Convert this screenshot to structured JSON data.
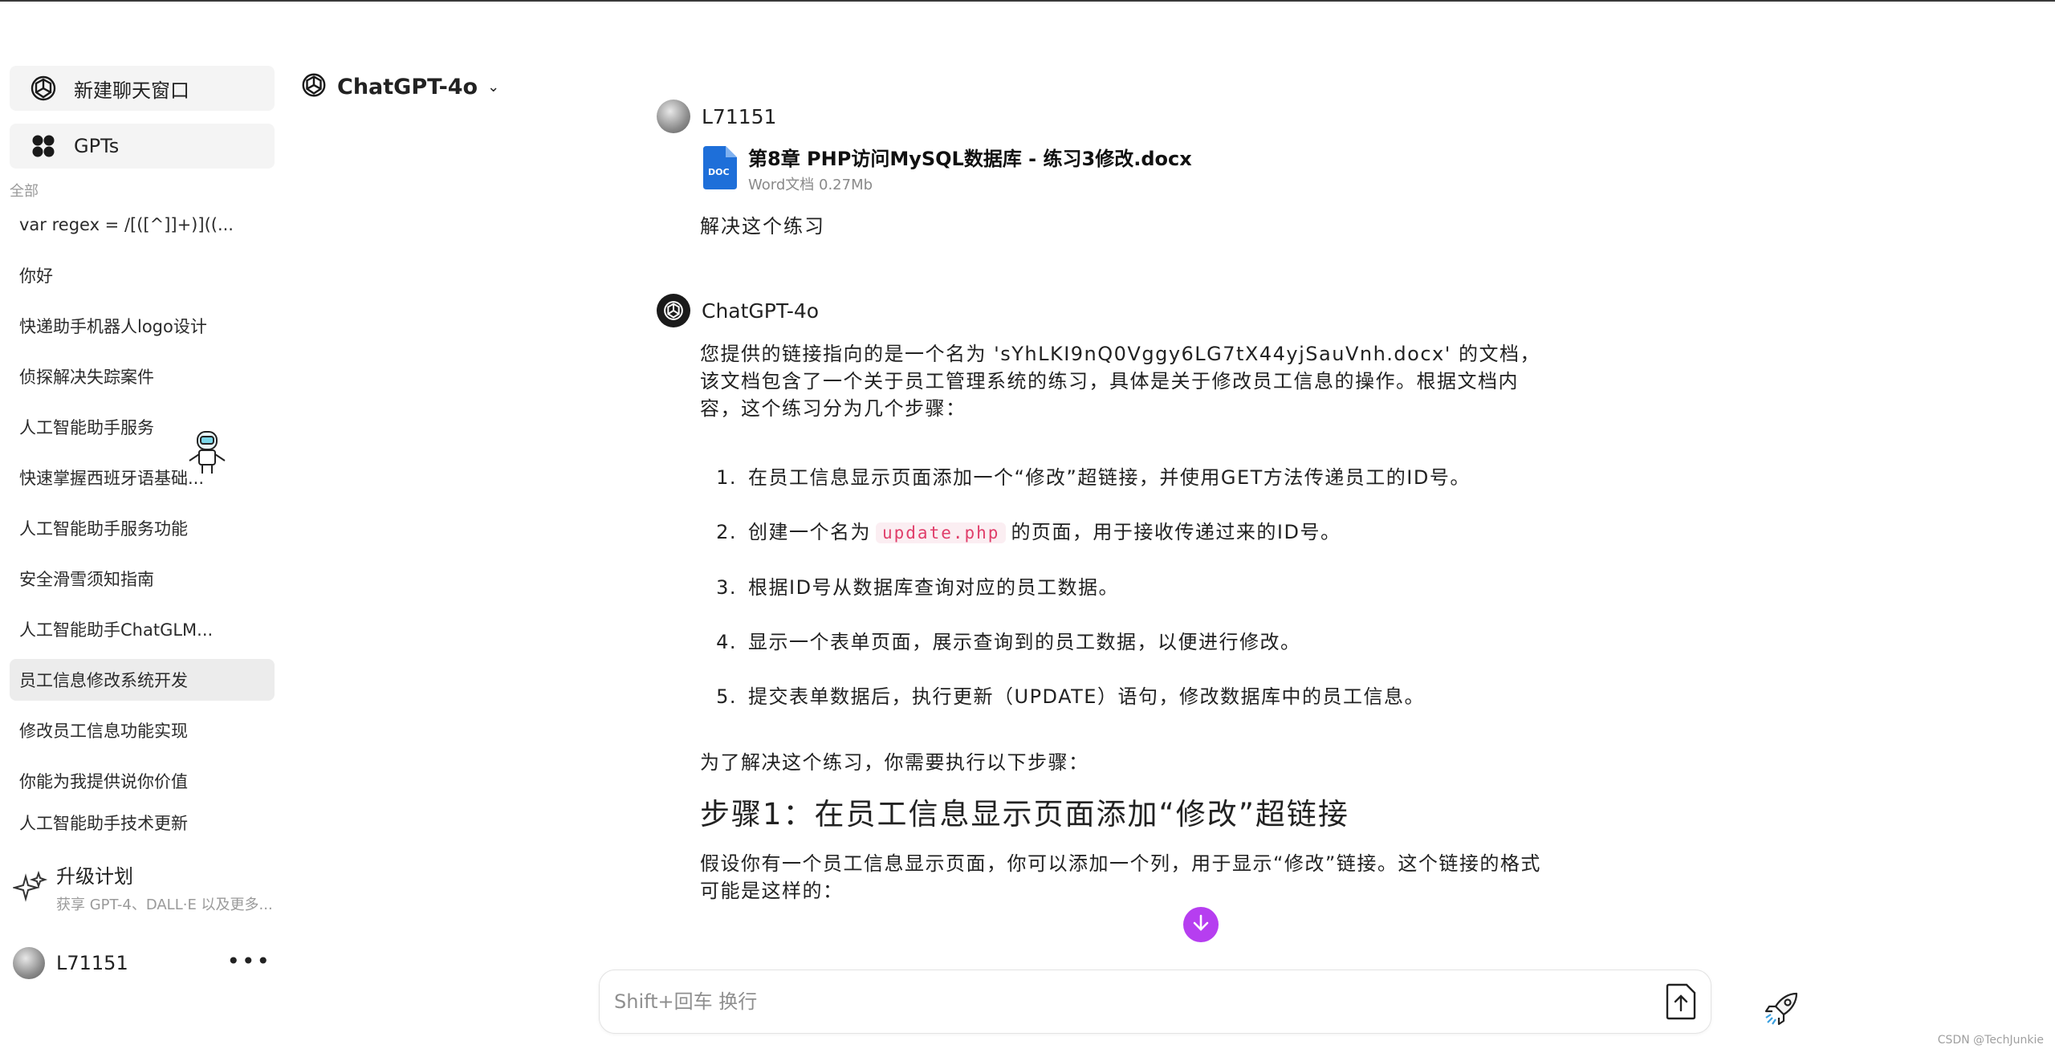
{
  "sidebar": {
    "new_chat": "新建聊天窗口",
    "gpts": "GPTs",
    "section": "全部",
    "history": [
      "var regex = /[([^]]+)]((...",
      "你好",
      "快递助手机器人logo设计",
      "侦探解决失踪案件",
      "人工智能助手服务",
      "快速掌握西班牙语基础...",
      "人工智能助手服务功能",
      "安全滑雪须知指南",
      "人工智能助手ChatGLM...",
      "员工信息修改系统开发",
      "修改员工信息功能实现",
      "你能为我提供说你价值",
      "人工智能助手技术更新"
    ],
    "active_index": 9,
    "upgrade_title": "升级计划",
    "upgrade_sub": "获享 GPT-4、DALL·E 以及更多...",
    "username": "L71151",
    "more": "•••"
  },
  "model": {
    "name": "ChatGPT-4o",
    "chevron": "⌄"
  },
  "chat": {
    "user_name": "L71151",
    "file_name": "第8章 PHP访问MySQL数据库 - 练习3修改.docx",
    "file_meta": "Word文档 0.27Mb",
    "file_icon_label": "DOC",
    "user_message": "解决这个练习",
    "bot_name": "ChatGPT-4o",
    "reply_intro": "您提供的链接指向的是一个名为 'sYhLKI9nQ0Vggy6LG7tX44yjSauVnh.docx' 的文档，该文档包含了一个关于员工管理系统的练习，具体是关于修改员工信息的操作。根据文档内容，这个练习分为几个步骤：",
    "steps": [
      {
        "num": "1.",
        "before": "在员工信息显示页面添加一个“修改”超链接，并使用GET方法传递员工的ID号。",
        "code": "",
        "after": ""
      },
      {
        "num": "2.",
        "before": "创建一个名为",
        "code": "update.php",
        "after": "的页面，用于接收传递过来的ID号。"
      },
      {
        "num": "3.",
        "before": "根据ID号从数据库查询对应的员工数据。",
        "code": "",
        "after": ""
      },
      {
        "num": "4.",
        "before": "显示一个表单页面，展示查询到的员工数据，以便进行修改。",
        "code": "",
        "after": ""
      },
      {
        "num": "5.",
        "before": "提交表单数据后，执行更新（UPDATE）语句，修改数据库中的员工信息。",
        "code": "",
        "after": ""
      }
    ],
    "reply_para2": "为了解决这个练习，你需要执行以下步骤：",
    "step_heading": "步骤1：在员工信息显示页面添加“修改”超链接",
    "reply_para3": "假设你有一个员工信息显示页面，你可以添加一个列，用于显示“修改”链接。这个链接的格式可能是这样的："
  },
  "input": {
    "placeholder": "Shift+回车 换行"
  },
  "watermark": "CSDN @TechJunkie",
  "colors": {
    "scroll_button": "#b63ef0",
    "code_text": "#e03e6a",
    "active_item": "#ececec"
  }
}
